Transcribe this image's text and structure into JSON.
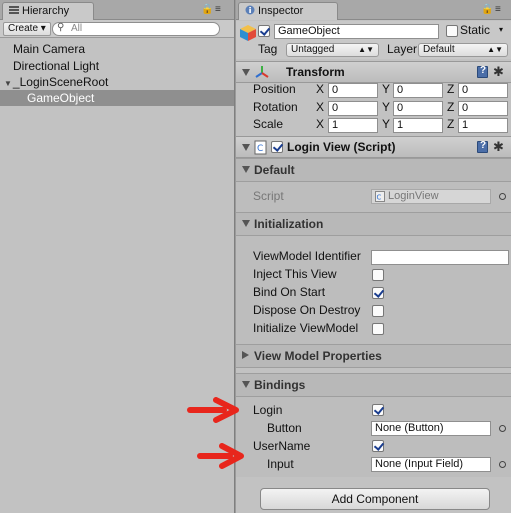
{
  "hierarchy": {
    "tab_label": "Hierarchy",
    "create_label": "Create",
    "search_placeholder": "All",
    "items": [
      {
        "label": "Main Camera"
      },
      {
        "label": "Directional Light"
      },
      {
        "label": "_LoginSceneRoot"
      },
      {
        "label": "GameObject"
      }
    ]
  },
  "inspector": {
    "tab_label": "Inspector",
    "object_name": "GameObject",
    "object_active": true,
    "static_label": "Static",
    "static_checked": false,
    "tag_label": "Tag",
    "tag_value": "Untagged",
    "layer_label": "Layer",
    "layer_value": "Default",
    "transform": {
      "title": "Transform",
      "position_label": "Position",
      "rotation_label": "Rotation",
      "scale_label": "Scale",
      "x_label": "X",
      "y_label": "Y",
      "z_label": "Z",
      "position": [
        "0",
        "0",
        "0"
      ],
      "rotation": [
        "0",
        "0",
        "0"
      ],
      "scale": [
        "1",
        "1",
        "1"
      ]
    },
    "login_view": {
      "title": "Login View (Script)",
      "enabled": true,
      "default_section": "Default",
      "script_label": "Script",
      "script_value": "LoginView",
      "initialization_section": "Initialization",
      "viewmodel_identifier_label": "ViewModel Identifier",
      "viewmodel_identifier_value": "",
      "inject_label": "Inject This View",
      "inject_checked": false,
      "bind_on_start_label": "Bind On Start",
      "bind_on_start_checked": true,
      "dispose_label": "Dispose On Destroy",
      "dispose_checked": false,
      "init_viewmodel_label": "Initialize ViewModel",
      "init_viewmodel_checked": false,
      "vm_props_section": "View Model Properties",
      "bindings_section": "Bindings",
      "login_label": "Login",
      "login_checked": true,
      "button_label": "Button",
      "button_value": "None (Button)",
      "username_label": "UserName",
      "username_checked": true,
      "input_label": "Input",
      "input_value": "None (Input Field)"
    },
    "add_component_label": "Add Component"
  },
  "colors": {
    "arrow": "#e8261c",
    "selection": "#8f8f8f",
    "panel": "#c2c2c2"
  }
}
